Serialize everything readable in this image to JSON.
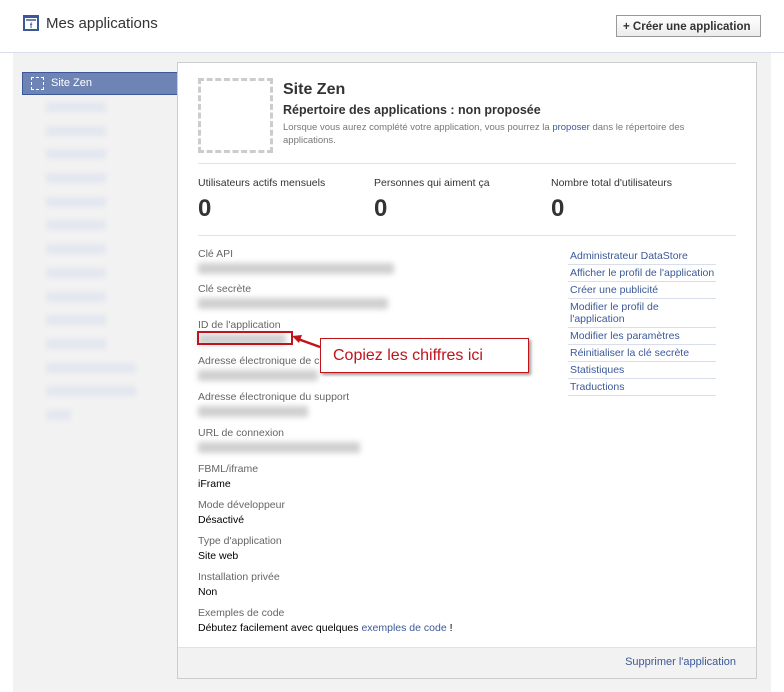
{
  "header": {
    "title": "Mes applications",
    "create_button": "+ Créer une application"
  },
  "sidebar": {
    "active_item": "Site Zen",
    "blurred_count": 14
  },
  "app": {
    "name": "Site Zen",
    "directory_status": "Répertoire des applications : non proposée",
    "directory_hint_before": "Lorsque vous aurez complété votre application, vous pourrez la ",
    "directory_hint_link": "proposer",
    "directory_hint_after": " dans le répertoire des applications."
  },
  "stats": [
    {
      "label": "Utilisateurs actifs mensuels",
      "value": "0"
    },
    {
      "label": "Personnes qui aiment ça",
      "value": "0"
    },
    {
      "label": "Nombre total d'utilisateurs",
      "value": "0"
    }
  ],
  "fields": {
    "api_key_label": "Clé API",
    "secret_label": "Clé secrète",
    "app_id_label": "ID de l'application",
    "contact_email_label": "Adresse électronique de c",
    "support_email_label": "Adresse électronique du support",
    "login_url_label": "URL de connexion",
    "fbml_label": "FBML/iframe",
    "fbml_value": "iFrame",
    "dev_mode_label": "Mode développeur",
    "dev_mode_value": "Désactivé",
    "app_type_label": "Type d'application",
    "app_type_value": "Site web",
    "private_install_label": "Installation privée",
    "private_install_value": "Non",
    "code_examples_label": "Exemples de code",
    "code_examples_before": "Débutez facilement avec quelques ",
    "code_examples_link": "exemples de code",
    "code_examples_after": " !"
  },
  "links": [
    "Administrateur DataStore",
    "Afficher le profil de l'application",
    "Créer une publicité",
    "Modifier le profil de l'application",
    "Modifier les paramètres",
    "Réinitialiser la clé secrète",
    "Statistiques",
    "Traductions"
  ],
  "footer": {
    "delete_link": "Supprimer l'application"
  },
  "annotation": {
    "callout_text": "Copiez les chiffres ici",
    "color": "#c0141b"
  },
  "colors": {
    "link": "#3b5998",
    "active_item_bg": "#6d84b4"
  }
}
